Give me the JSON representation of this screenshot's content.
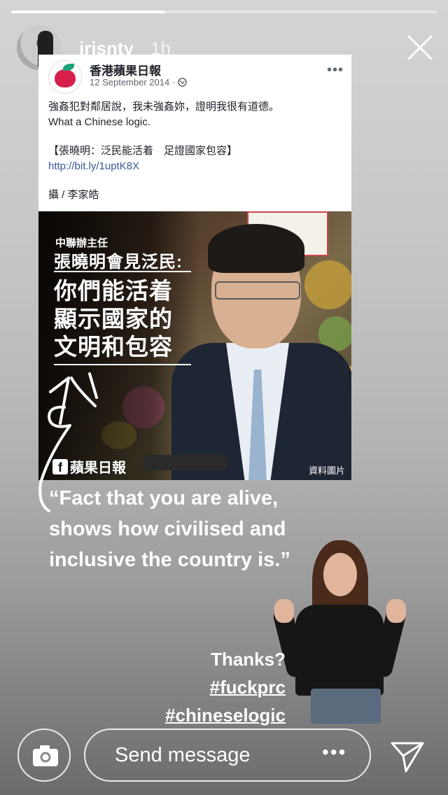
{
  "story": {
    "progress": [
      0.36
    ],
    "username": "irisnty",
    "time_ago": "1h"
  },
  "post": {
    "page_name": "香港蘋果日報",
    "date": "12 September 2014 ·",
    "text_lines": [
      "強姦犯對鄰居說，我未強姦妳，證明我很有道德。",
      "What a Chinese logic."
    ],
    "headline": "【張曉明：泛民能活着　足證國家包容】",
    "link": "http://bit.ly/1uptK8X",
    "credit": "攝 /  李家皓"
  },
  "article_image": {
    "caption_small": "中聯辦主任",
    "caption_name": "張曉明會見泛民:",
    "caption_lines": [
      "你們能活着",
      "顯示國家的",
      "文明和包容"
    ],
    "brand": "蘋果日報",
    "file_photo": "資料圖片"
  },
  "overlay": {
    "quote_lines": [
      "“Fact that you are alive,",
      "shows how civilised and",
      "inclusive the country is.”"
    ],
    "thanks": "Thanks?",
    "tags": [
      "#fuckprc",
      "#chineselogic"
    ]
  },
  "bottom_bar": {
    "placeholder": "Send message"
  }
}
